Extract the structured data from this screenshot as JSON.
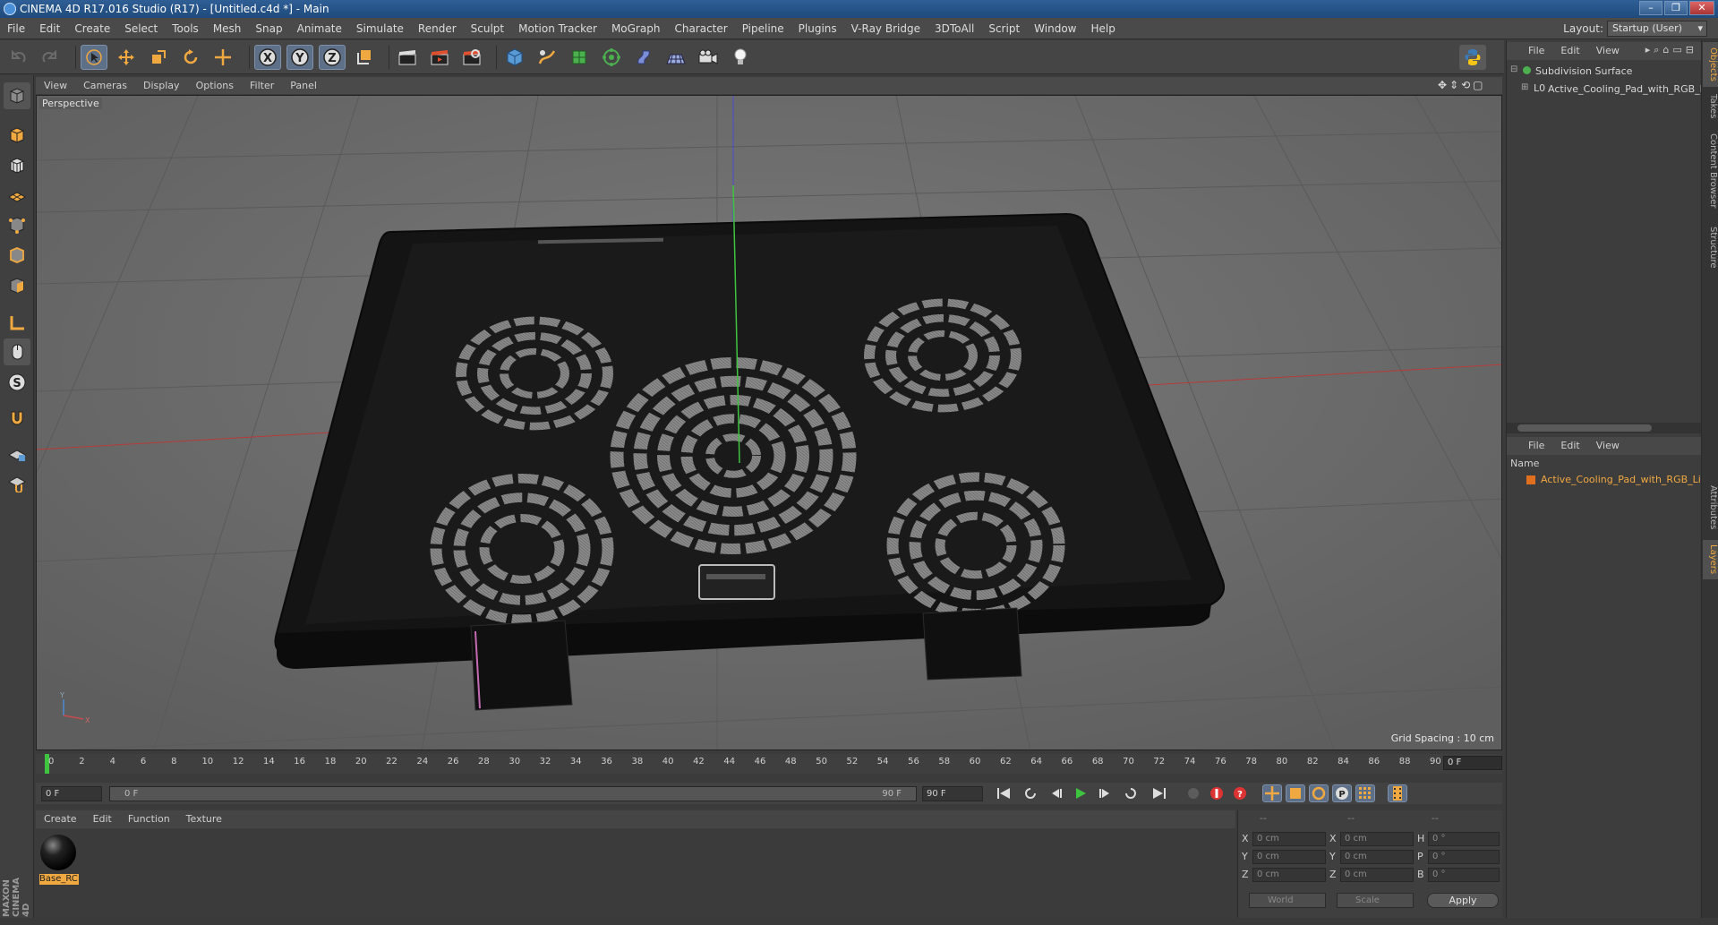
{
  "window": {
    "title": "CINEMA 4D R17.016 Studio (R17) - [Untitled.c4d *] - Main",
    "controls": [
      "–",
      "❐",
      "✕"
    ]
  },
  "menubar": {
    "items": [
      "File",
      "Edit",
      "Create",
      "Select",
      "Tools",
      "Mesh",
      "Snap",
      "Animate",
      "Simulate",
      "Render",
      "Sculpt",
      "Motion Tracker",
      "MoGraph",
      "Character",
      "Pipeline",
      "Plugins",
      "V-Ray Bridge",
      "3DToAll",
      "Script",
      "Window",
      "Help"
    ],
    "layout_label": "Layout:",
    "layout_value": "Startup (User)"
  },
  "viewport": {
    "menu": [
      "View",
      "Cameras",
      "Display",
      "Options",
      "Filter",
      "Panel"
    ],
    "label": "Perspective",
    "grid_spacing": "Grid Spacing : 10 cm"
  },
  "timeline": {
    "ticks": [
      "0",
      "2",
      "4",
      "6",
      "8",
      "10",
      "12",
      "14",
      "16",
      "18",
      "20",
      "22",
      "24",
      "26",
      "28",
      "30",
      "32",
      "34",
      "36",
      "38",
      "40",
      "42",
      "44",
      "46",
      "48",
      "50",
      "52",
      "54",
      "56",
      "58",
      "60",
      "62",
      "64",
      "66",
      "68",
      "70",
      "72",
      "74",
      "76",
      "78",
      "80",
      "82",
      "84",
      "86",
      "88",
      "90"
    ],
    "current_frame": "0 F",
    "start_field": "0 F",
    "range_start": "0 F",
    "range_end": "90 F",
    "end_field": "90 F"
  },
  "materials": {
    "menu": [
      "Create",
      "Edit",
      "Function",
      "Texture"
    ],
    "items": [
      {
        "name": "Base_RC"
      }
    ]
  },
  "coordinates": {
    "header": [
      "--",
      "--",
      "--"
    ],
    "rows": [
      {
        "l1": "X",
        "v1": "0 cm",
        "l2": "X",
        "v2": "0 cm",
        "l3": "H",
        "v3": "0 °"
      },
      {
        "l1": "Y",
        "v1": "0 cm",
        "l2": "Y",
        "v2": "0 cm",
        "l3": "P",
        "v3": "0 °"
      },
      {
        "l1": "Z",
        "v1": "0 cm",
        "l2": "Z",
        "v2": "0 cm",
        "l3": "B",
        "v3": "0 °"
      }
    ],
    "mode1": "World",
    "mode2": "Scale",
    "apply": "Apply"
  },
  "objects_panel": {
    "menu": [
      "File",
      "Edit",
      "View"
    ],
    "items": [
      {
        "name": "Subdivision Surface"
      },
      {
        "name": "Active_Cooling_Pad_with_RGB_Li"
      }
    ]
  },
  "layers_panel": {
    "menu": [
      "File",
      "Edit",
      "View"
    ],
    "column_header": "Name",
    "items": [
      {
        "name": "Active_Cooling_Pad_with_RGB_Lig"
      }
    ]
  },
  "side_tabs": [
    "Objects",
    "Takes",
    "Content Browser",
    "Structure",
    "Attributes",
    "Layers"
  ],
  "brand": "MAXON CINEMA 4D",
  "colors": {
    "accent": "#f0a840",
    "selection": "#5e6f88",
    "viewport_bg": "#6b6b6b"
  }
}
